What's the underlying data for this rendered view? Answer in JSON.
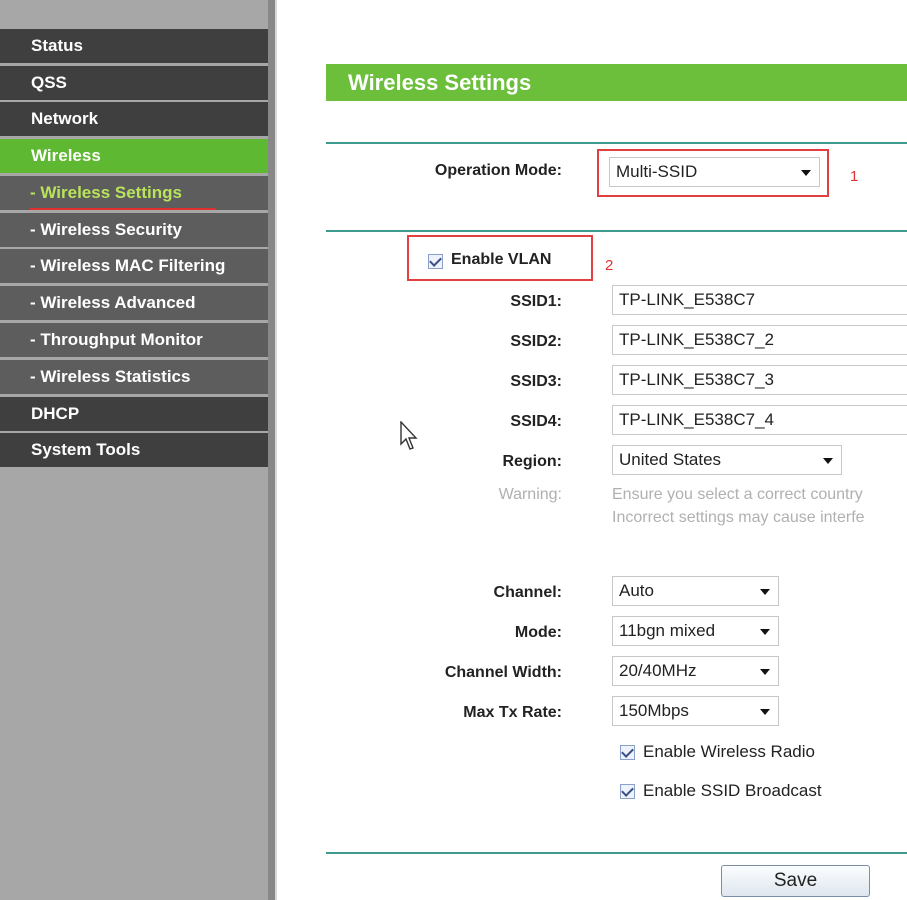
{
  "sidebar": {
    "items": [
      {
        "label": "Status"
      },
      {
        "label": "QSS"
      },
      {
        "label": "Network"
      },
      {
        "label": "Wireless"
      },
      {
        "label": "- Wireless Settings"
      },
      {
        "label": "- Wireless Security"
      },
      {
        "label": "- Wireless MAC Filtering"
      },
      {
        "label": "- Wireless Advanced"
      },
      {
        "label": "- Throughput Monitor"
      },
      {
        "label": "- Wireless Statistics"
      },
      {
        "label": "DHCP"
      },
      {
        "label": "System Tools"
      }
    ]
  },
  "page": {
    "title": "Wireless Settings"
  },
  "form": {
    "operation_mode": {
      "label": "Operation Mode:",
      "value": "Multi-SSID",
      "annotation": "1"
    },
    "enable_vlan": {
      "label": "Enable VLAN",
      "checked": true,
      "annotation": "2"
    },
    "ssids": [
      {
        "label": "SSID1:",
        "value": "TP-LINK_E538C7"
      },
      {
        "label": "SSID2:",
        "value": "TP-LINK_E538C7_2"
      },
      {
        "label": "SSID3:",
        "value": "TP-LINK_E538C7_3"
      },
      {
        "label": "SSID4:",
        "value": "TP-LINK_E538C7_4"
      }
    ],
    "region": {
      "label": "Region:",
      "value": "United States"
    },
    "warning": {
      "label": "Warning:",
      "line1": "Ensure you select a correct country",
      "line2": "Incorrect settings may cause interfe"
    },
    "channel": {
      "label": "Channel:",
      "value": "Auto"
    },
    "mode": {
      "label": "Mode:",
      "value": "11bgn mixed"
    },
    "channel_width": {
      "label": "Channel Width:",
      "value": "20/40MHz"
    },
    "max_tx_rate": {
      "label": "Max Tx Rate:",
      "value": "150Mbps"
    },
    "enable_wireless_radio": {
      "label": "Enable Wireless Radio",
      "checked": true
    },
    "enable_ssid_broadcast": {
      "label": "Enable SSID Broadcast",
      "checked": true
    },
    "save_label": "Save"
  },
  "colors": {
    "accent_green": "#6bbf3b",
    "nav_dark": "#3f3f3f",
    "annotation_red": "#e03030",
    "divider_teal": "#3e9b8e"
  }
}
